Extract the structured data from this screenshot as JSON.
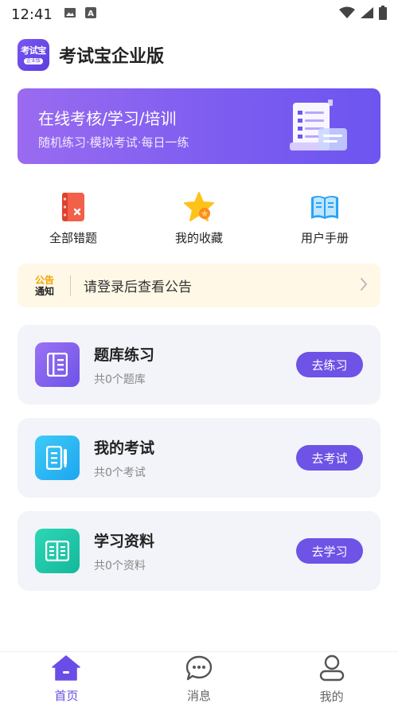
{
  "status_bar": {
    "time": "12:41",
    "icons": [
      "image-icon",
      "a-badge-icon",
      "wifi-icon",
      "signal-icon",
      "battery-icon"
    ]
  },
  "header": {
    "logo_main": "考试宝",
    "logo_sub": "企业版",
    "title": "考试宝企业版"
  },
  "banner": {
    "title": "在线考核/学习/培训",
    "subtitle": "随机练习·模拟考试·每日一练"
  },
  "quick_actions": [
    {
      "label": "全部错题",
      "icon": "error-book-icon"
    },
    {
      "label": "我的收藏",
      "icon": "star-icon"
    },
    {
      "label": "用户手册",
      "icon": "manual-book-icon"
    }
  ],
  "notice": {
    "badge_top": "公告",
    "badge_bottom": "通知",
    "text": "请登录后查看公告"
  },
  "cards": [
    {
      "title": "题库练习",
      "subtitle": "共0个题库",
      "button": "去练习",
      "icon": "question-bank-icon"
    },
    {
      "title": "我的考试",
      "subtitle": "共0个考试",
      "button": "去考试",
      "icon": "exam-icon"
    },
    {
      "title": "学习资料",
      "subtitle": "共0个资料",
      "button": "去学习",
      "icon": "study-material-icon"
    }
  ],
  "bottom_nav": [
    {
      "label": "首页",
      "icon": "home-icon",
      "active": true
    },
    {
      "label": "消息",
      "icon": "message-icon",
      "active": false
    },
    {
      "label": "我的",
      "icon": "profile-icon",
      "active": false
    }
  ],
  "colors": {
    "accent": "#6e53e6",
    "notice_bg": "#fff8e6",
    "card_bg": "#f2f4f9"
  }
}
